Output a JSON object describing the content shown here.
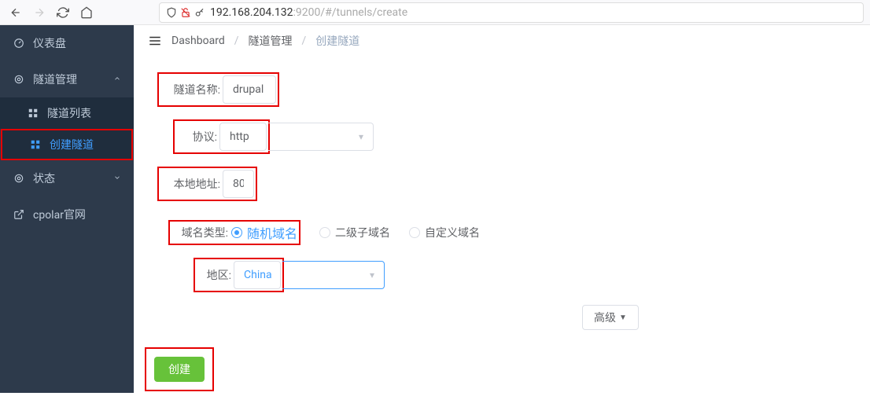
{
  "browser": {
    "url_dark": "192.168.204.132",
    "url_rest": ":9200/#/tunnels/create"
  },
  "sidebar": {
    "items": [
      {
        "label": "仪表盘",
        "icon": "dashboard"
      },
      {
        "label": "隧道管理",
        "icon": "circle",
        "expanded": true
      },
      {
        "label": "隧道列表",
        "icon": "grid",
        "child": true
      },
      {
        "label": "创建隧道",
        "icon": "grid",
        "child": true,
        "active": true,
        "highlight": true
      },
      {
        "label": "状态",
        "icon": "circle",
        "collapsed": true
      },
      {
        "label": "cpolar官网",
        "icon": "external"
      }
    ]
  },
  "breadcrumb": {
    "items": [
      "Dashboard",
      "隧道管理",
      "创建隧道"
    ]
  },
  "form": {
    "name_label": "隧道名称:",
    "name_value": "drupal",
    "proto_label": "协议:",
    "proto_value": "http",
    "addr_label": "本地地址:",
    "addr_value": "80",
    "domain_label": "域名类型:",
    "domain_options": [
      "随机域名",
      "二级子域名",
      "自定义域名"
    ],
    "domain_selected": 0,
    "region_label": "地区:",
    "region_value": "China",
    "advanced_label": "高级",
    "create_label": "创建"
  }
}
